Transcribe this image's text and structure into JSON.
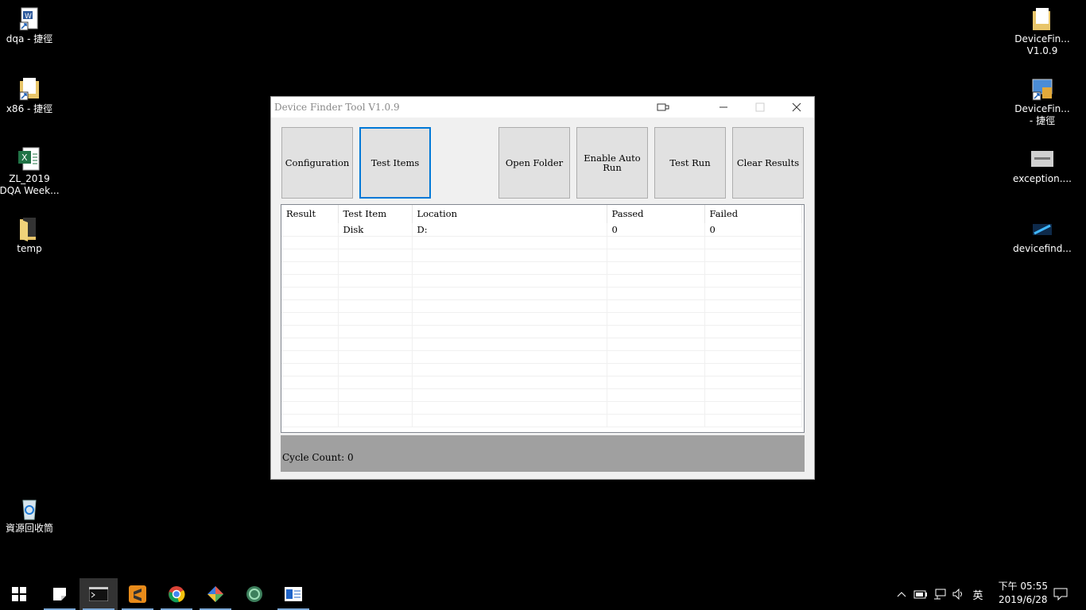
{
  "desktop": {
    "left_icons": [
      {
        "label": "dqa - 捷徑"
      },
      {
        "label": "x86 - 捷徑"
      },
      {
        "label": "ZL_2019",
        "label2": "DQA Week..."
      },
      {
        "label": "temp"
      },
      {
        "label": "資源回收筒"
      }
    ],
    "right_icons": [
      {
        "label": "DeviceFin...",
        "label2": "V1.0.9"
      },
      {
        "label": "DeviceFin...",
        "label2": "- 捷徑"
      },
      {
        "label": "exception...."
      },
      {
        "label": "devicefind..."
      }
    ]
  },
  "window": {
    "title": "Device Finder Tool V1.0.9",
    "buttons": {
      "configuration": "Configuration",
      "test_items": "Test Items",
      "open_folder": "Open Folder",
      "enable_auto_run": "Enable Auto Run",
      "test_run": "Test Run",
      "clear_results": "Clear Results"
    },
    "table": {
      "columns": [
        "Result",
        "Test Item",
        "Location",
        "Passed",
        "Failed"
      ],
      "rows": [
        {
          "result": "",
          "test_item": "Disk",
          "location": "D:",
          "passed": "0",
          "failed": "0"
        }
      ]
    },
    "status": "Cycle Count: 0"
  },
  "taskbar": {
    "clock_time": "下午 05:55",
    "clock_date": "2019/6/28",
    "ime": "英"
  }
}
